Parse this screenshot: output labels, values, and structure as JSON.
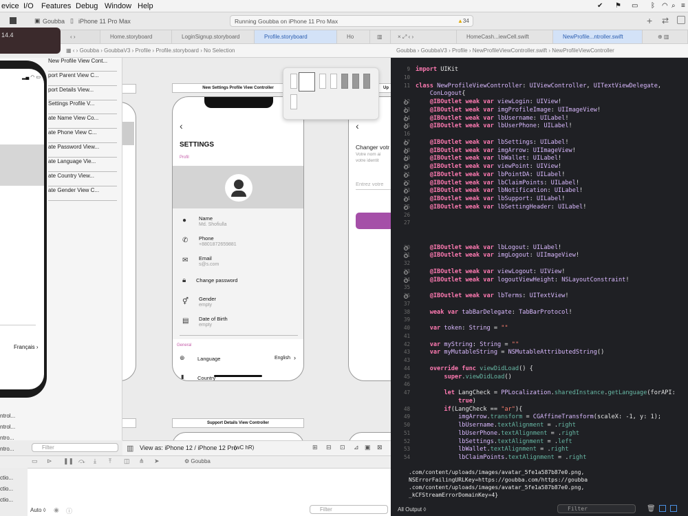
{
  "menubar": {
    "items": [
      "evice",
      "I/O",
      "Features",
      "Debug",
      "Window",
      "Help"
    ],
    "status_icons": [
      "check-icon",
      "flag-icon",
      "battery-icon",
      "bluetooth-icon",
      "wifi-icon",
      "search-icon",
      "control-center-icon",
      "notification-icon"
    ]
  },
  "toolbar": {
    "scheme": "Goubba",
    "device": "iPhone 11 Pro Max",
    "status": "Running Goubba on iPhone 11 Pro Max",
    "warnings": "34"
  },
  "simulator": {
    "version_label": "14.4"
  },
  "tabs": {
    "left": [
      "Home.storyboard",
      "LoginSignup.storyboard",
      "Profile.storyboard",
      "Ho"
    ],
    "right": [
      "HomeCash...iewCell.swift",
      "NewProfile...ntroller.swift"
    ]
  },
  "jumpbar_left": [
    "Goubba",
    "GoubbaV3",
    "Profile",
    "Profile.storyboard",
    "No Selection"
  ],
  "jumpbar_right": [
    "Goubba",
    "GoubbaV3",
    "Profile",
    "NewProfileViewController.swift",
    "NewProfileViewController"
  ],
  "outline": {
    "items": [
      "New Profile View Cont...",
      "port Parent View C...",
      "port Details View...",
      "Settings Profile V...",
      "ate Name View Co...",
      "ate Phone View C...",
      "ate Password View...",
      "ate Language Vie...",
      "ate Country View...",
      "ate Gender View C..."
    ],
    "lower_items": [
      "ntrol...",
      "ntrol...",
      "ntro...",
      "ntro...",
      "ctio...",
      "ctio...",
      "ctio..."
    ],
    "filter_placeholder": "Filter"
  },
  "device": {
    "language_value": "Français"
  },
  "canvas": {
    "settings_vc_label": "New Settings Profile View Controller",
    "support_vc_label": "Support Details View Controller",
    "side_label": "Up",
    "settings": {
      "title": "SETTINGS",
      "profile_section": "Profil",
      "rows": [
        {
          "title": "Name",
          "value": "Md. Shofiulla",
          "icon": "person-icon"
        },
        {
          "title": "Phone",
          "value": "+8801872659881",
          "icon": "phone-icon"
        },
        {
          "title": "Email",
          "value": "s@s.com",
          "icon": "email-icon"
        },
        {
          "title": "Change password",
          "value": "",
          "icon": "lock-icon"
        },
        {
          "title": "Gender",
          "value": "empty",
          "icon": "gender-icon"
        },
        {
          "title": "Date of Birth",
          "value": "empty",
          "icon": "calendar-icon"
        }
      ],
      "general_section": "General",
      "language_label": "Language",
      "language_value": "English",
      "country_label": "Country"
    },
    "update_vc": {
      "title": "Changer votr",
      "line1": "Votre nom ai",
      "line2": "votre identit",
      "placeholder": "Entrez votre"
    }
  },
  "bottombar": {
    "view_as": "View as: iPhone 12 / iPhone 12 Pro",
    "modifiers": "(wC hR)"
  },
  "debugbar": {
    "target": "Goubba"
  },
  "vars": {
    "mode": "Auto ◊",
    "filter_placeholder": "Filter"
  },
  "console": {
    "lines": [
      ".com/content/uploads/images/avatar_5fe1a587b87e0.png,",
      "NSErrorFailingURLKey=https://goubba.com/https://goubba",
      ".com/content/uploads/images/avatar_5fe1a587b87e0.png,",
      "_kCFStreamErrorDomainKey=4}"
    ],
    "output_selector": "All Output ◊",
    "filter_placeholder": "Filter"
  },
  "code": {
    "lines": [
      {
        "n": "9",
        "dot": false,
        "html": "<span class='kw'>import</span> UIKit"
      },
      {
        "n": "10",
        "dot": false,
        "html": ""
      },
      {
        "n": "11",
        "dot": false,
        "html": "<span class='kw'>class</span> <span class='ty'>NewProfileViewController</span>: <span class='ty'>UIViewController</span>, <span class='ty'>UITextViewDelegate</span>,"
      },
      {
        "n": "",
        "dot": false,
        "html": "    <span class='ty'>ConLogout</span>{"
      },
      {
        "n": "12",
        "dot": true,
        "html": "    <span class='kw'>@IBOutlet weak var</span> <span class='ty'>viewLogin</span>: <span class='ty'>UIView</span>!"
      },
      {
        "n": "13",
        "dot": true,
        "html": "    <span class='kw'>@IBOutlet weak var</span> <span class='ty'>imgProfileImage</span>: <span class='ty'>UIImageView</span>!"
      },
      {
        "n": "14",
        "dot": true,
        "html": "    <span class='kw'>@IBOutlet weak var</span> <span class='ty'>lbUsername</span>: <span class='ty'>UILabel</span>!"
      },
      {
        "n": "15",
        "dot": true,
        "html": "    <span class='kw'>@IBOutlet weak var</span> <span class='ty'>lbUserPhone</span>: <span class='ty'>UILabel</span>!"
      },
      {
        "n": "16",
        "dot": false,
        "html": ""
      },
      {
        "n": "17",
        "dot": true,
        "html": "    <span class='kw'>@IBOutlet weak var</span> <span class='ty'>lbSettings</span>: <span class='ty'>UILabel</span>!"
      },
      {
        "n": "18",
        "dot": true,
        "html": "    <span class='kw'>@IBOutlet weak var</span> <span class='ty'>imgArrow</span>: <span class='ty'>UIImageView</span>!"
      },
      {
        "n": "19",
        "dot": true,
        "html": "    <span class='kw'>@IBOutlet weak var</span> <span class='ty'>lbWallet</span>: <span class='ty'>UILabel</span>!"
      },
      {
        "n": "20",
        "dot": true,
        "html": "    <span class='kw'>@IBOutlet weak var</span> <span class='ty'>viewPoint</span>: <span class='ty'>UIView</span>!"
      },
      {
        "n": "21",
        "dot": true,
        "html": "    <span class='kw'>@IBOutlet weak var</span> <span class='ty'>lbPointDA</span>: <span class='ty'>UILabel</span>!"
      },
      {
        "n": "22",
        "dot": true,
        "html": "    <span class='kw'>@IBOutlet weak var</span> <span class='ty'>lbClaimPoints</span>: <span class='ty'>UILabel</span>!"
      },
      {
        "n": "23",
        "dot": true,
        "html": "    <span class='kw'>@IBOutlet weak var</span> <span class='ty'>lbNotification</span>: <span class='ty'>UILabel</span>!"
      },
      {
        "n": "24",
        "dot": true,
        "html": "    <span class='kw'>@IBOutlet weak var</span> <span class='ty'>lbSupport</span>: <span class='ty'>UILabel</span>!"
      },
      {
        "n": "25",
        "dot": true,
        "html": "    <span class='kw'>@IBOutlet weak var</span> <span class='ty'>lbSettingHeader</span>: <span class='ty'>UILabel</span>!"
      },
      {
        "n": "26",
        "dot": false,
        "html": ""
      },
      {
        "n": "27",
        "dot": false,
        "html": ""
      },
      {
        "n": "",
        "dot": false,
        "html": ""
      },
      {
        "n": "",
        "dot": false,
        "html": ""
      },
      {
        "n": "30",
        "dot": true,
        "html": "    <span class='kw'>@IBOutlet weak var</span> <span class='ty'>lbLogout</span>: <span class='ty'>UILabel</span>!"
      },
      {
        "n": "31",
        "dot": true,
        "html": "    <span class='kw'>@IBOutlet weak var</span> <span class='ty'>imgLogout</span>: <span class='ty'>UIImageView</span>!"
      },
      {
        "n": "32",
        "dot": false,
        "html": ""
      },
      {
        "n": "33",
        "dot": true,
        "html": "    <span class='kw'>@IBOutlet weak var</span> <span class='ty'>viewLogout</span>: <span class='ty'>UIView</span>!"
      },
      {
        "n": "34",
        "dot": true,
        "html": "    <span class='kw'>@IBOutlet weak var</span> <span class='ty'>logoutViewHeight</span>: <span class='ty'>NSLayoutConstraint</span>!"
      },
      {
        "n": "35",
        "dot": false,
        "html": ""
      },
      {
        "n": "36",
        "dot": true,
        "html": "    <span class='kw'>@IBOutlet weak var</span> <span class='ty'>lbTerms</span>: <span class='ty'>UITextView</span>!"
      },
      {
        "n": "37",
        "dot": false,
        "html": ""
      },
      {
        "n": "38",
        "dot": false,
        "html": "    <span class='kw'>weak var</span> <span class='ty'>tabBarDelegate</span>: <span class='ty'>TabBarProtocol</span>!"
      },
      {
        "n": "39",
        "dot": false,
        "html": ""
      },
      {
        "n": "40",
        "dot": false,
        "html": "    <span class='kw'>var</span> <span class='ty'>token</span>: <span class='ty'>String</span> = <span class='st'>\"\"</span>"
      },
      {
        "n": "41",
        "dot": false,
        "html": ""
      },
      {
        "n": "42",
        "dot": false,
        "html": "    <span class='kw'>var</span> <span class='ty'>myString</span>: <span class='ty'>String</span> = <span class='st'>\"\"</span>"
      },
      {
        "n": "43",
        "dot": false,
        "html": "    <span class='kw'>var</span> <span class='ty'>myMutableString</span> = <span class='ty'>NSMutableAttributedString</span>()"
      },
      {
        "n": "43",
        "dot": false,
        "html": ""
      },
      {
        "n": "44",
        "dot": false,
        "html": "    <span class='kw'>override func</span> <span class='fn'>viewDidLoad</span>() {"
      },
      {
        "n": "45",
        "dot": false,
        "html": "        <span class='kw'>super</span>.<span class='fn'>viewDidLoad</span>()"
      },
      {
        "n": "46",
        "dot": false,
        "html": ""
      },
      {
        "n": "47",
        "dot": false,
        "html": "        <span class='kw'>let</span> LangCheck = <span class='ty'>PPLocalization</span>.<span class='fn'>sharedInstance</span>.<span class='fn'>getLanguage</span>(forAPI:"
      },
      {
        "n": "",
        "dot": false,
        "html": "            <span class='kw'>true</span>)"
      },
      {
        "n": "48",
        "dot": false,
        "html": "        <span class='kw'>if</span>(LangCheck == <span class='st'>\"ar\"</span>){"
      },
      {
        "n": "49",
        "dot": false,
        "html": "            <span class='ty'>imgArrow</span>.<span class='fn'>transform</span> = <span class='ty'>CGAffineTransform</span>(scaleX: -1, y: 1);"
      },
      {
        "n": "50",
        "dot": false,
        "html": "            <span class='ty'>lbUsername</span>.<span class='fn'>textAlignment</span> = .<span class='fn'>right</span>"
      },
      {
        "n": "51",
        "dot": false,
        "html": "            <span class='ty'>lbUserPhone</span>.<span class='fn'>textAlignment</span> = .<span class='fn'>right</span>"
      },
      {
        "n": "52",
        "dot": false,
        "html": "            <span class='ty'>lbSettings</span>.<span class='fn'>textAlignment</span> = .<span class='fn'>left</span>"
      },
      {
        "n": "53",
        "dot": false,
        "html": "            <span class='ty'>lbWallet</span>.<span class='fn'>textAlignment</span> = .<span class='fn'>right</span>"
      },
      {
        "n": "54",
        "dot": false,
        "html": "            <span class='ty'>lbClaimPoints</span>.<span class='fn'>textAlignment</span> = .<span class='fn'>right</span>"
      }
    ]
  }
}
